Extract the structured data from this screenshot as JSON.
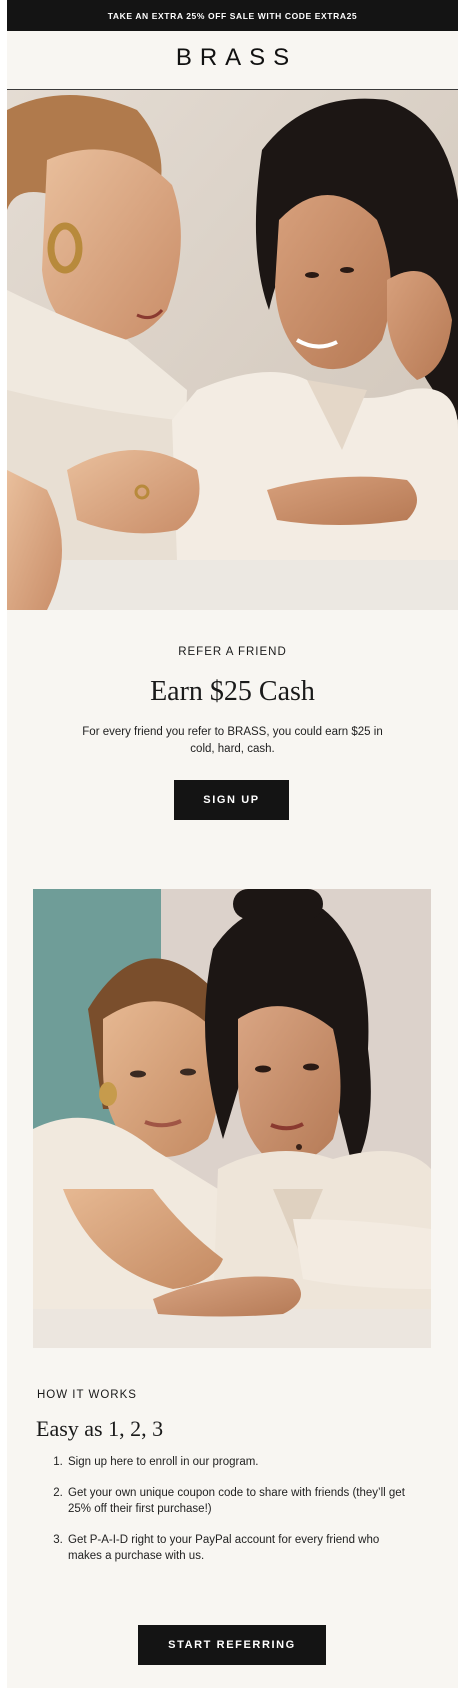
{
  "promo_bar": {
    "text": "TAKE AN EXTRA 25% OFF SALE WITH CODE EXTRA25"
  },
  "header": {
    "logo": "BRASS"
  },
  "referral": {
    "eyebrow": "REFER A FRIEND",
    "headline": "Earn $25 Cash",
    "body": "For every friend you refer to BRASS, you could earn $25 in cold, hard, cash.",
    "cta_label": "SIGN UP"
  },
  "how_it_works": {
    "eyebrow": "HOW IT WORKS",
    "headline": "Easy as 1, 2, 3",
    "steps": [
      "Sign up here to enroll in our program.",
      "Get your own unique coupon code to share with friends (they’ll get 25% off their first purchase!)",
      "Get P-A-I-D right to your PayPal account for every friend who makes a purchase with us."
    ],
    "cta_label": "START REFERRING"
  },
  "colors": {
    "background": "#f8f6f2",
    "button": "#141414",
    "promo_bar": "#141414"
  }
}
